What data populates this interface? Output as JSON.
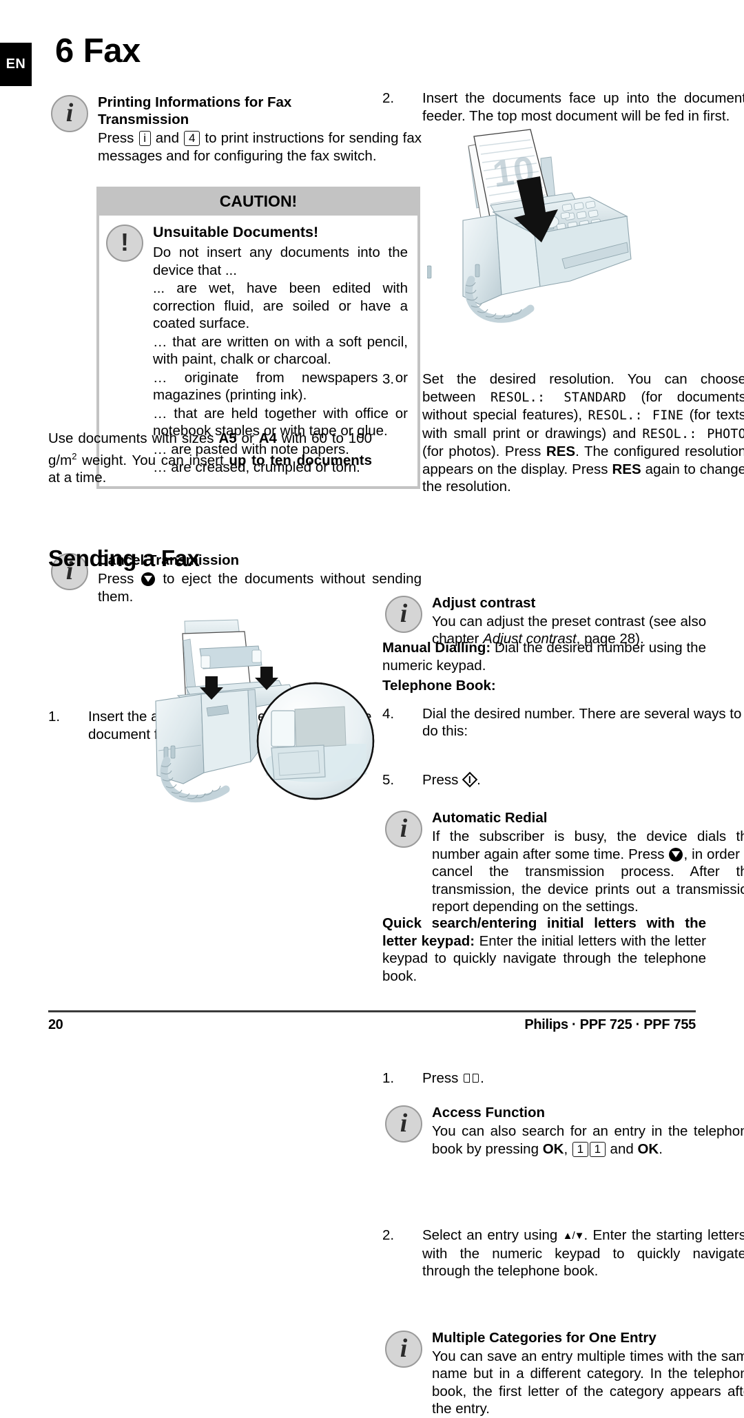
{
  "page": {
    "language_tab": "EN",
    "chapter_number": "6",
    "chapter_title": "Fax",
    "footer_page_number": "20",
    "footer_model": "Philips · PPF 725 · PPF 755"
  },
  "left_column": {
    "note_printing": {
      "icon": "info-icon",
      "title_line1": "Printing Informations for Fax",
      "title_line2": "Transmission",
      "body_before": "Press",
      "key1": "i",
      "body_mid": "and",
      "key2": "4",
      "body_after": "to print instructions for sending fax messages and for configuring the fax switch."
    },
    "caution": {
      "header": "CAUTION!",
      "icon": "exclamation-icon",
      "title": "Unsuitable Documents!",
      "items": [
        "Do not insert any documents into the device that ...",
        "... are wet, have been edited with correction fluid, are soiled or have a coated surface.",
        "… that are written on with a soft pencil, with paint, chalk or charcoal.",
        "… originate from newspapers or magazines (printing ink).",
        "… that are held together with office or notebook staples or with tape or glue.",
        "… are pasted with note papers.",
        "… are creased, crumpled or torn."
      ]
    },
    "paper_spec": {
      "p1": "Use documents with sizes ",
      "b1": "A5",
      "p2": " or ",
      "b2": "A4",
      "p3": " with 60 to 100 g/m",
      "sup": "2",
      "p4": " weight. You can insert ",
      "b3": "up to ten documents",
      "p5": " at a time."
    },
    "note_cancel": {
      "icon": "info-icon",
      "title": "Cancel Transmission",
      "body_before": "Press",
      "symbol": "stop-symbol",
      "body_after": "to eject the documents without sending them."
    },
    "section_heading": "Sending a Fax",
    "step1": {
      "number": "1.",
      "text": "Insert the additional document support on the document feeder."
    },
    "illustration_1": "fax-machine-document-support-illustration"
  },
  "right_column": {
    "step2": {
      "number": "2.",
      "text": "Insert the documents face up into the document feeder. The top most document will be fed in first."
    },
    "illustration_2": "fax-machine-insert-documents-illustration",
    "step3": {
      "number": "3.",
      "t1": "Set the desired resolution. You can choose between ",
      "lcd1": "RESOL.: STANDARD",
      "t2": " (for documents without special features), ",
      "lcd2": "RESOL.: FINE",
      "t3": " (for texts with small print or drawings) and ",
      "lcd3": "RESOL.: PHOTO",
      "t4": " (for photos). Press ",
      "b1": "RES",
      "t5": ". The configured resolution appears on the display. Press ",
      "b2": "RES",
      "t6": " again to change the resolution."
    },
    "note_contrast": {
      "icon": "info-icon",
      "title": "Adjust contrast",
      "t1": "You can adjust the preset contrast (see also chapter ",
      "italic": "Adjust contrast",
      "t2": ", page 28)."
    },
    "step4": {
      "number": "4.",
      "text": "Dial the desired number. There are several ways to do this:"
    },
    "step5": {
      "number": "5.",
      "text_before": "Press",
      "symbol": "start-symbol",
      "text_after": "."
    },
    "note_redial": {
      "icon": "info-icon",
      "title": "Automatic Redial",
      "t1": "If the subscriber is busy, the device dials the number again after some time. Press ",
      "symbol": "stop-symbol",
      "t2": ", in order to cancel the transmission process. After the transmission, the device prints out a transmission report depending on the settings."
    },
    "manual_dialling": {
      "label": "Manual Dialling:",
      "text": " Dial the desired number using the numeric keypad."
    },
    "telephone_book_label": "Telephone Book:",
    "tb_step1": {
      "number": "1.",
      "text_before": "Press",
      "symbol": "book-symbol",
      "text_after": "."
    },
    "note_access": {
      "icon": "info-icon",
      "title": "Access Function",
      "t1": "You can also search for an entry in the telephone book by pressing ",
      "b1": "OK",
      "t2": ", ",
      "key1": "1",
      "key2": "1",
      "t3": " and ",
      "b2": "OK",
      "t4": "."
    },
    "tb_step2": {
      "number": "2.",
      "t1": "Select an entry using ",
      "symbol": "up-down-arrows",
      "t2": ". Enter the starting letters with the numeric keypad to quickly navigate through the telephone book."
    },
    "note_categories": {
      "icon": "info-icon",
      "title": "Multiple Categories for One Entry",
      "text": "You can save an entry multiple times with the same name but in a different category. In the telephone book, the first letter of the category appears after the entry."
    },
    "quick_search": {
      "label": "Quick search/entering initial letters with the letter keypad:",
      "text": " Enter the initial letters with the letter keypad to quickly navigate through the telephone book."
    }
  },
  "colors": {
    "caution_band": "#c3c3c3",
    "icon_fill": "#d5d5d5",
    "icon_border": "#9a9a9a",
    "tab_background": "#000000",
    "device_body": "#dfe7ea",
    "device_shadow": "#b7c6cc"
  }
}
